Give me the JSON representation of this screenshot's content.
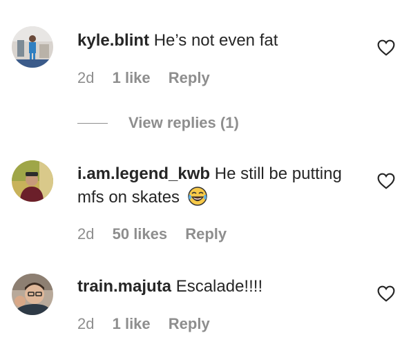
{
  "comments": [
    {
      "username": "kyle.blint",
      "text": "He’s not even fat",
      "time": "2d",
      "likes": "1 like",
      "reply_label": "Reply"
    },
    {
      "username": "i.am.legend_kwb",
      "text": "He still be putting mfs on skates",
      "emoji": "face-with-tears-of-joy",
      "time": "2d",
      "likes": "50 likes",
      "reply_label": "Reply"
    },
    {
      "username": "train.majuta",
      "text": "Escalade!!!!",
      "time": "2d",
      "likes": "1 like",
      "reply_label": "Reply"
    }
  ],
  "view_replies_label": "View replies (1)",
  "colors": {
    "text": "#262626",
    "secondary": "#8e8e8e",
    "background": "#ffffff"
  }
}
